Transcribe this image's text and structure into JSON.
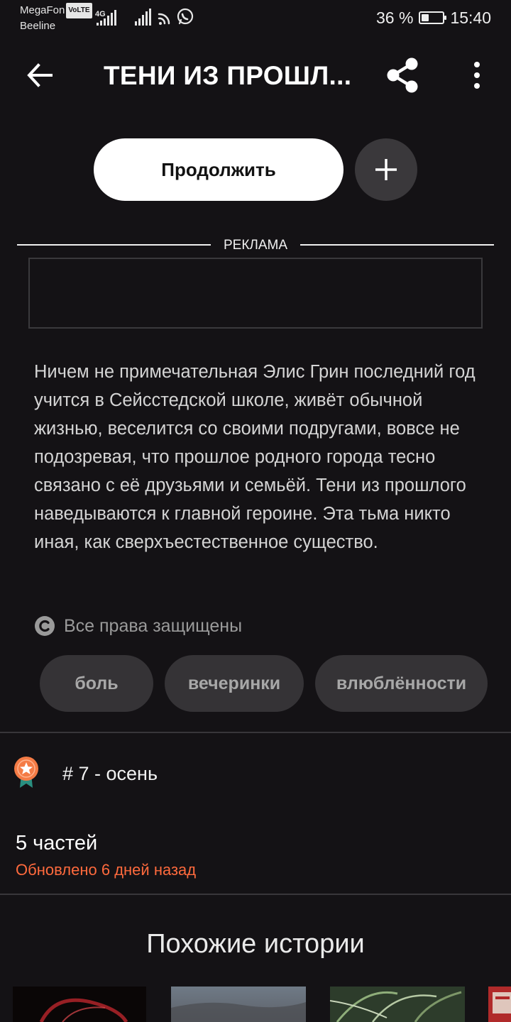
{
  "status_bar": {
    "carrier_1": "MegaFon",
    "volte_badge": "VoLTE",
    "carrier_2": "Beeline",
    "network_4g": "4G",
    "battery_text": "36 %",
    "battery_level": 0.36,
    "time": "15:40"
  },
  "header": {
    "title": "ТЕНИ ИЗ ПРОШЛ...",
    "back_icon": "arrow-left-icon",
    "share_icon": "share-icon",
    "more_icon": "more-vertical-icon"
  },
  "actions": {
    "continue_label": "Продолжить",
    "add_icon": "plus-icon"
  },
  "ad": {
    "label": "РЕКЛАМА"
  },
  "description": "Ничем не примечательная Элис Грин последний год учится в Сейсстедской школе, живёт обычной жизнью, веселится со своими подругами, вовсе не подозревая, что прошлое родного города тесно связано с её друзьями и семьёй. Тени из прошлого наведываются к главной героине. Эта тьма никто иная, как сверхъестественное существо.",
  "copyright": {
    "icon": "copyright-icon",
    "text": "Все права защищены"
  },
  "tags": [
    "боль",
    "вечеринки",
    "влюблённости"
  ],
  "ranking": {
    "icon": "medal-icon",
    "text": "# 7 - осень"
  },
  "story_info": {
    "parts": "5 частей",
    "updated": "Обновлено 6 дней назад"
  },
  "similar": {
    "title": "Похожие истории"
  },
  "colors": {
    "background": "#141215",
    "accent": "#ff6a3d",
    "tag_background": "#353336",
    "medal_orange": "#f47b45",
    "medal_ribbon": "#2a8f80"
  }
}
